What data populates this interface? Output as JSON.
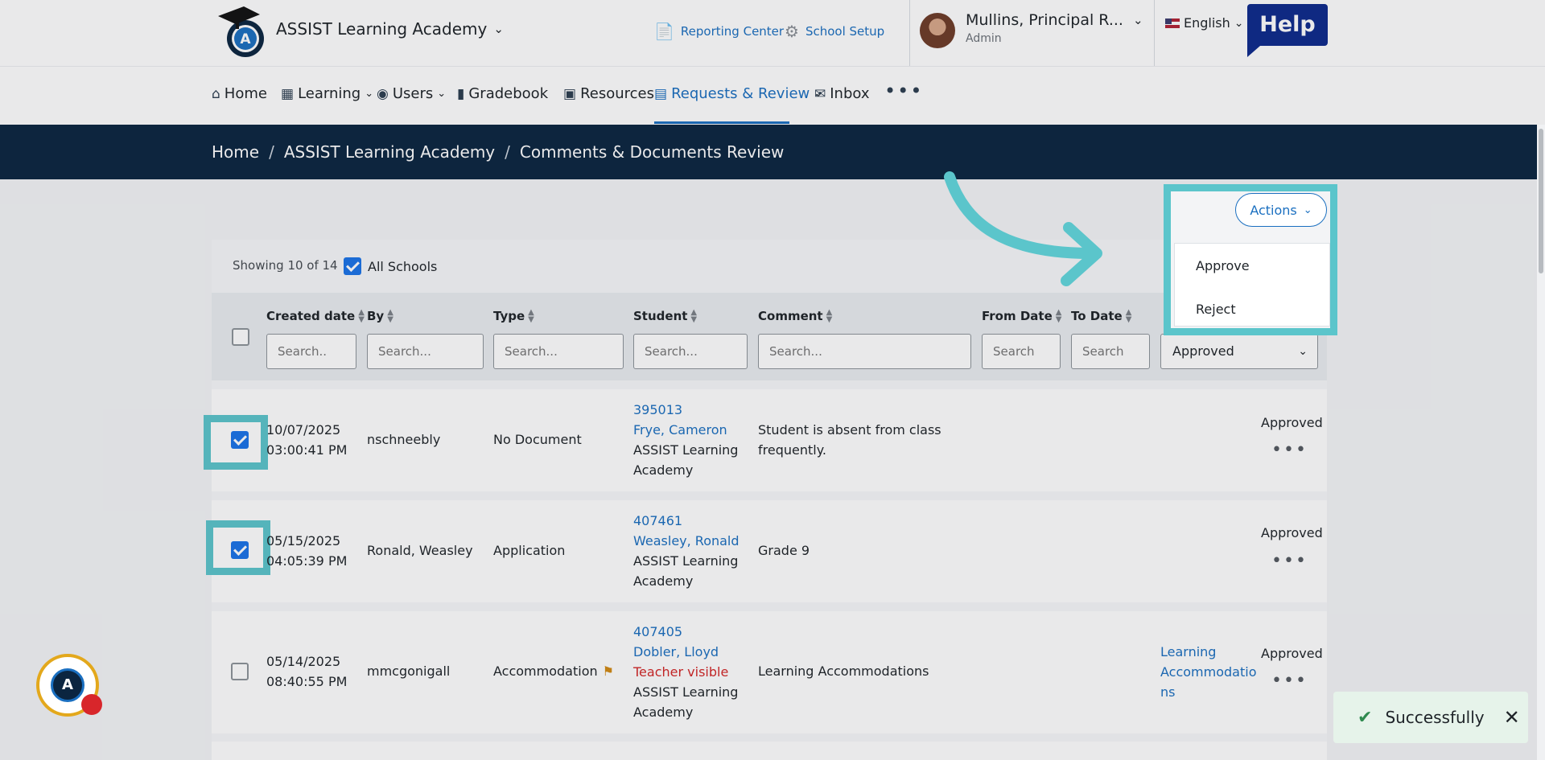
{
  "header": {
    "school_name": "ASSIST Learning Academy",
    "reporting_center": "Reporting Center",
    "school_setup": "School Setup",
    "user_name": "Mullins, Principal R...",
    "user_role": "Admin",
    "language": "English",
    "help": "Help"
  },
  "nav": {
    "home": "Home",
    "learning": "Learning",
    "users": "Users",
    "gradebook": "Gradebook",
    "resources": "Resources",
    "requests_review": "Requests & Review",
    "inbox": "Inbox"
  },
  "breadcrumb": {
    "home": "Home",
    "school": "ASSIST Learning Academy",
    "page": "Comments & Documents Review"
  },
  "toolbar": {
    "showing": "Showing 10 of 14",
    "all_schools": "All Schools",
    "actions": "Actions",
    "actions_menu": [
      "Approve",
      "Reject"
    ]
  },
  "table": {
    "columns": {
      "created_date": "Created date",
      "by": "By",
      "type": "Type",
      "student": "Student",
      "comment": "Comment",
      "from_date": "From Date",
      "to_date": "To Date"
    },
    "filters": {
      "created_date": "Search..",
      "by": "Search...",
      "type": "Search...",
      "student": "Search...",
      "comment": "Search...",
      "from_date": "Search",
      "to_date": "Search",
      "status": "Approved"
    },
    "rows": [
      {
        "date": "10/07/2025",
        "time": "03:00:41 PM",
        "by": "nschneebly",
        "type": "No Document",
        "student_id": "395013",
        "student_name": "Frye, Cameron",
        "school_l1": "ASSIST Learning",
        "school_l2": "Academy",
        "comment_l1": "Student is absent from class",
        "comment_l2": "frequently.",
        "status": "Approved",
        "checked": true
      },
      {
        "date": "05/15/2025",
        "time": "04:05:39 PM",
        "by": "Ronald, Weasley",
        "type": "Application",
        "student_id": "407461",
        "student_name": "Weasley, Ronald",
        "school_l1": "ASSIST Learning",
        "school_l2": "Academy",
        "comment_l1": "Grade 9",
        "status": "Approved",
        "checked": true
      },
      {
        "date": "05/14/2025",
        "time": "08:40:55 PM",
        "by": "mmcgonigall",
        "type": "Accommodation",
        "student_id": "407405",
        "student_name": "Dobler, Lloyd",
        "visibility": "Teacher visible",
        "school_l1": "ASSIST Learning",
        "school_l2": "Academy",
        "comment_l1": "Learning Accommodations",
        "document_l1": "Learning",
        "document_l2": "Accommodatio",
        "document_l3": "ns",
        "status": "Approved",
        "checked": false
      }
    ]
  },
  "toast": {
    "message": "Successfully"
  },
  "colors": {
    "accent": "#1a6fc0",
    "highlight": "#5bc5cb",
    "breadcrumb_bg": "#0b2540",
    "help_bg": "#0d2a8c",
    "visibility_red": "#d32525"
  }
}
